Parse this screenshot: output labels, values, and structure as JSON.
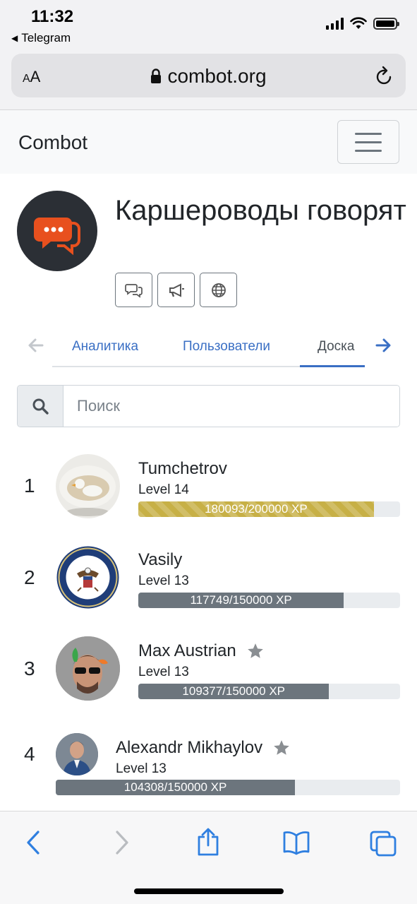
{
  "status_bar": {
    "time": "11:32",
    "back_app": "Telegram"
  },
  "address_bar": {
    "text_size_label": "AA",
    "url": "combot.org"
  },
  "navbar": {
    "brand": "Combot"
  },
  "group": {
    "title": "Каршероводы говорят",
    "buttons": [
      "chat-icon",
      "megaphone-icon",
      "globe-icon"
    ]
  },
  "tabs": {
    "items": [
      {
        "label": "Аналитика",
        "active": false
      },
      {
        "label": "Пользователи",
        "active": false
      },
      {
        "label": "Доска",
        "active": true
      }
    ]
  },
  "search": {
    "placeholder": "Поиск"
  },
  "leaderboard": [
    {
      "rank": "1",
      "name": "Tumchetrov",
      "level": "Level 14",
      "xp_text": "180093/200000 XP",
      "progress_fraction": 0.9,
      "style": "gold",
      "starred": false,
      "avatar": "duck-photo"
    },
    {
      "rank": "2",
      "name": "Vasily",
      "level": "Level 13",
      "xp_text": "117749/150000 XP",
      "progress_fraction": 0.785,
      "style": "grey",
      "starred": false,
      "avatar": "department-of-state-seal"
    },
    {
      "rank": "3",
      "name": "Max Austrian",
      "level": "Level 13",
      "xp_text": "109377/150000 XP",
      "progress_fraction": 0.729,
      "style": "grey",
      "starred": true,
      "avatar": "man-with-sunglasses-photo"
    },
    {
      "rank": "4",
      "name": "Alexandr Mikhaylov",
      "level": "Level 13",
      "xp_text": "104308/150000 XP",
      "progress_fraction": 0.695,
      "style": "grey",
      "starred": true,
      "avatar": "man-in-suit-photo"
    }
  ],
  "colors": {
    "link": "#3a6fc4",
    "gold_bar": "#c7b046",
    "grey_bar": "#6c757d",
    "star": "#8a8e92",
    "ios_blue": "#2f7fe0"
  }
}
